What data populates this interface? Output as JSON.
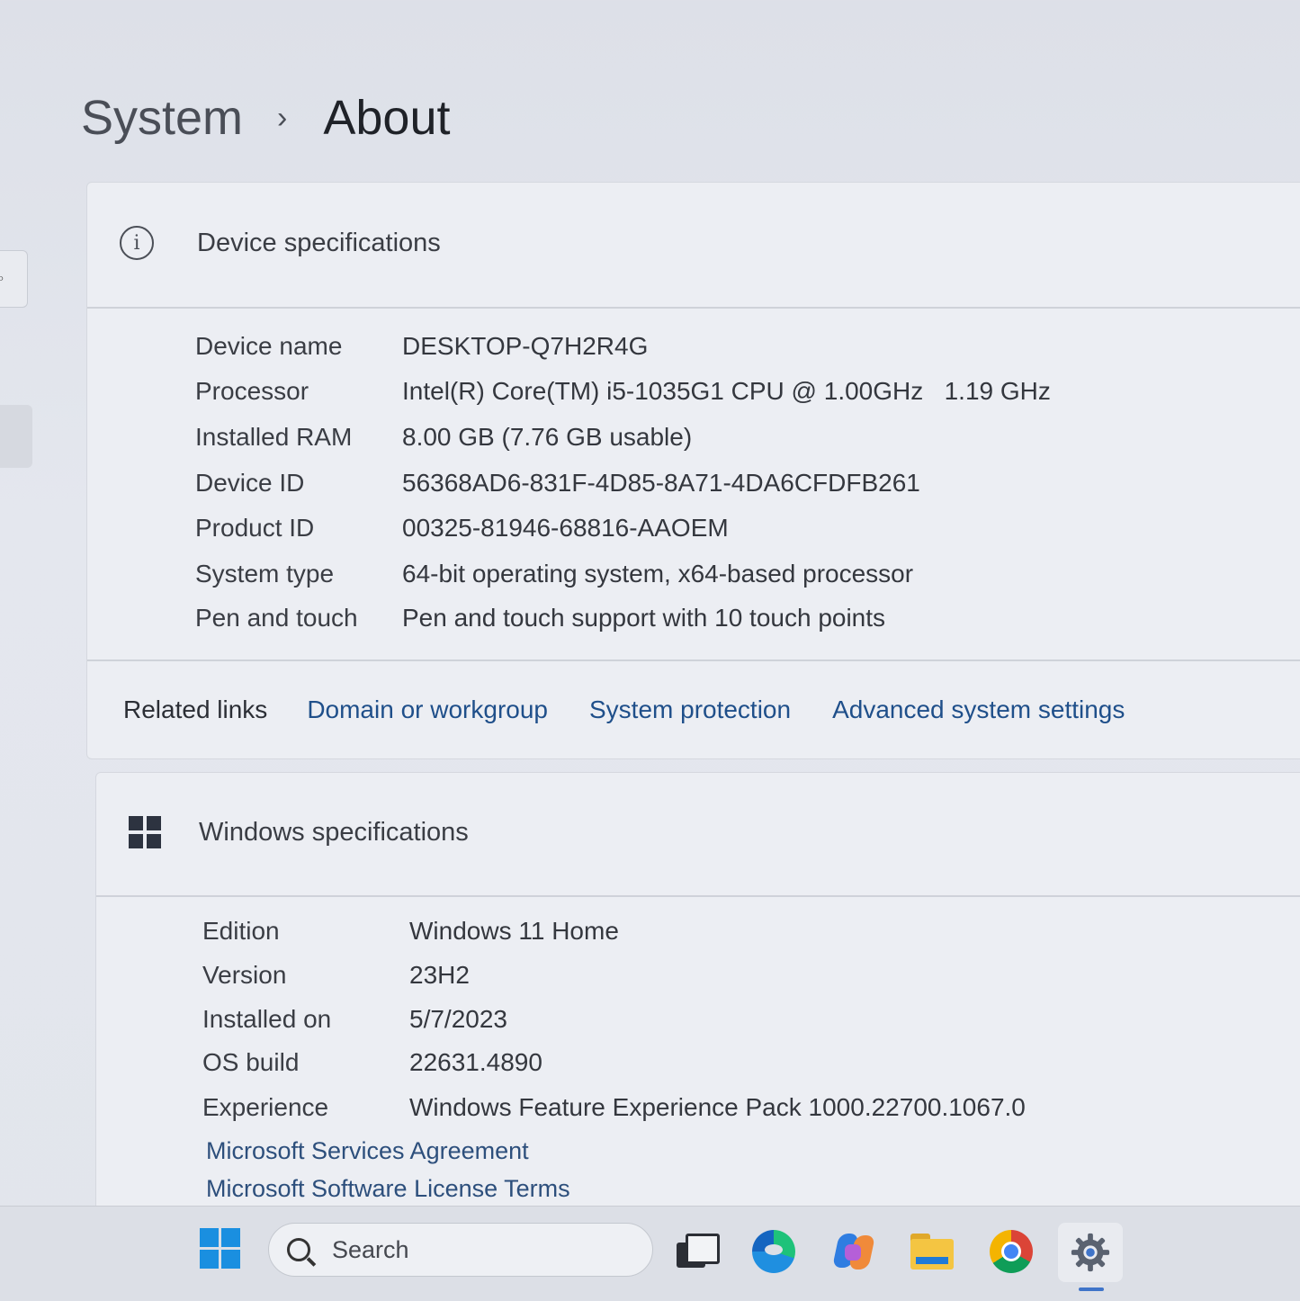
{
  "breadcrumb": {
    "parent": "System",
    "separator": "›",
    "current": "About"
  },
  "device_specifications": {
    "title": "Device specifications",
    "icon": "info-icon",
    "rows": [
      {
        "label": "Device name",
        "value": "DESKTOP-Q7H2R4G"
      },
      {
        "label": "Processor",
        "value": "Intel(R) Core(TM) i5-1035G1 CPU @ 1.00GHz   1.19 GHz"
      },
      {
        "label": "Installed RAM",
        "value": "8.00 GB (7.76 GB usable)"
      },
      {
        "label": "Device ID",
        "value": "56368AD6-831F-4D85-8A71-4DA6CFDFB261"
      },
      {
        "label": "Product ID",
        "value": "00325-81946-68816-AAOEM"
      },
      {
        "label": "System type",
        "value": "64-bit operating system, x64-based processor"
      },
      {
        "label": "Pen and touch",
        "value": "Pen and touch support with 10 touch points"
      }
    ]
  },
  "related_links": {
    "label": "Related links",
    "links": [
      "Domain or workgroup",
      "System protection",
      "Advanced system settings"
    ]
  },
  "windows_specifications": {
    "title": "Windows specifications",
    "icon": "windows-logo-icon",
    "rows": [
      {
        "label": "Edition",
        "value": "Windows 11 Home"
      },
      {
        "label": "Version",
        "value": "23H2"
      },
      {
        "label": "Installed on",
        "value": "5/7/2023"
      },
      {
        "label": "OS build",
        "value": "22631.4890"
      },
      {
        "label": "Experience",
        "value": "Windows Feature Experience Pack 1000.22700.1067.0"
      }
    ],
    "links": [
      "Microsoft Services Agreement",
      "Microsoft Software License Terms"
    ]
  },
  "taskbar": {
    "search_placeholder": "Search",
    "icons": [
      "start-icon",
      "search-icon",
      "task-view-icon",
      "edge-icon",
      "copilot-icon",
      "file-explorer-icon",
      "chrome-icon",
      "settings-icon"
    ],
    "active_app": "settings-icon",
    "accent": "#1a8fe0"
  }
}
